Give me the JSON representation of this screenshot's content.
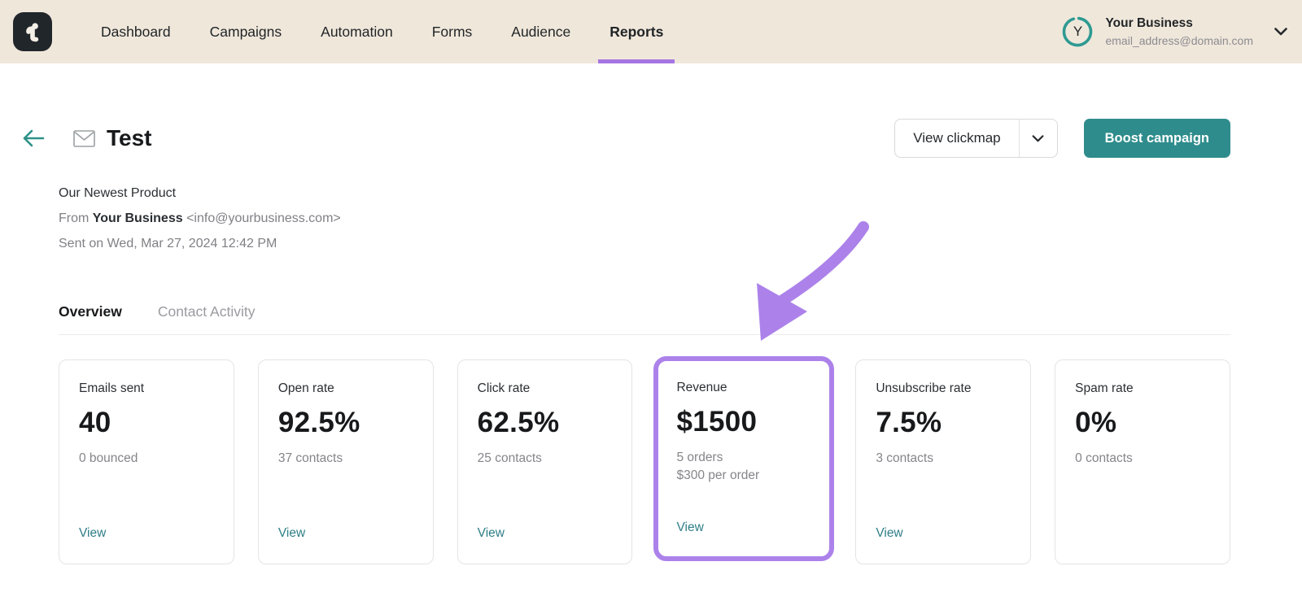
{
  "nav": {
    "items": [
      {
        "label": "Dashboard",
        "active": false
      },
      {
        "label": "Campaigns",
        "active": false
      },
      {
        "label": "Automation",
        "active": false
      },
      {
        "label": "Forms",
        "active": false
      },
      {
        "label": "Audience",
        "active": false
      },
      {
        "label": "Reports",
        "active": true
      }
    ],
    "user": {
      "name": "Your Business",
      "email": "email_address@domain.com",
      "avatar_initial": "Y"
    }
  },
  "header": {
    "title": "Test",
    "view_clickmap_label": "View clickmap",
    "boost_label": "Boost campaign"
  },
  "campaign": {
    "subject": "Our Newest Product",
    "from_label": "From",
    "from_name": "Your Business",
    "from_email": "<info@yourbusiness.com>",
    "sent_line": "Sent on Wed, Mar 27, 2024 12:42 PM"
  },
  "tabs": [
    {
      "label": "Overview",
      "active": true
    },
    {
      "label": "Contact Activity",
      "active": false
    }
  ],
  "stats": {
    "cards": [
      {
        "label": "Emails sent",
        "value": "40",
        "sub": [
          "0 bounced"
        ],
        "view": "View",
        "highlighted": false
      },
      {
        "label": "Open rate",
        "value": "92.5%",
        "sub": [
          "37 contacts"
        ],
        "view": "View",
        "highlighted": false
      },
      {
        "label": "Click rate",
        "value": "62.5%",
        "sub": [
          "25 contacts"
        ],
        "view": "View",
        "highlighted": false
      },
      {
        "label": "Revenue",
        "value": "$1500",
        "sub": [
          "5 orders",
          "$300 per order"
        ],
        "view": "View",
        "highlighted": true
      },
      {
        "label": "Unsubscribe rate",
        "value": "7.5%",
        "sub": [
          "3 contacts"
        ],
        "view": "View",
        "highlighted": false
      },
      {
        "label": "Spam rate",
        "value": "0%",
        "sub": [
          "0 contacts"
        ],
        "view": null,
        "highlighted": false
      }
    ]
  },
  "colors": {
    "nav_background": "#f0e7db",
    "accent_teal_button": "#2f8c8c",
    "teal_link": "#2e7e87",
    "avatar_ring_teal": "#2e9a92",
    "highlight_purple": "#ac82ea",
    "nav_underline_purple": "#a676e3"
  }
}
